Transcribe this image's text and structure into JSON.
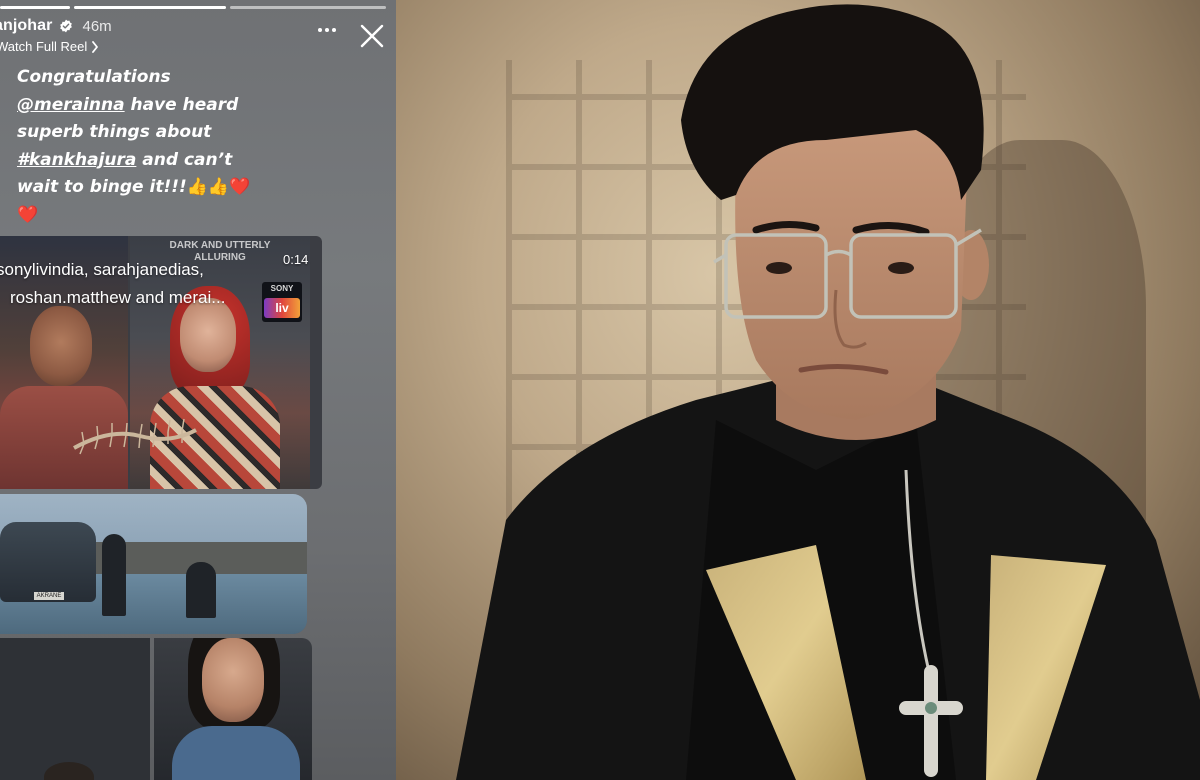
{
  "story": {
    "username": "karanjohar",
    "username_visible": "anjohar",
    "time_ago": "46m",
    "watch_reel_label": "Watch Full Reel",
    "caption": {
      "line1": "Congratulations",
      "mention": "@merainna",
      "line2_rest": " have heard",
      "line3": "superb things about",
      "hashtag": "#kankhajura",
      "line4_rest": " and can’t",
      "line5": "wait to binge it!!!",
      "emojis_inline": "👍👍❤️",
      "emoji_last": "❤️"
    },
    "reel": {
      "overlay_line1": "sonylivindia, sarahjanedias,",
      "overlay_line2": "roshan.matthew and merai...",
      "duration": "0:14",
      "poster_tagline": "DARK AND UTTERLY ALLURING",
      "badge_top": "SONY",
      "badge_logo": "liv",
      "car_plate": "AKRANE"
    }
  },
  "colors": {
    "story_bg": "#737578",
    "photo_bg": "#bfa98a",
    "verified_blue": "#3897f0"
  },
  "icons": {
    "verified": "verified-badge-icon",
    "more": "more-options-icon",
    "close": "close-icon",
    "chevron": "chevron-right-icon"
  }
}
